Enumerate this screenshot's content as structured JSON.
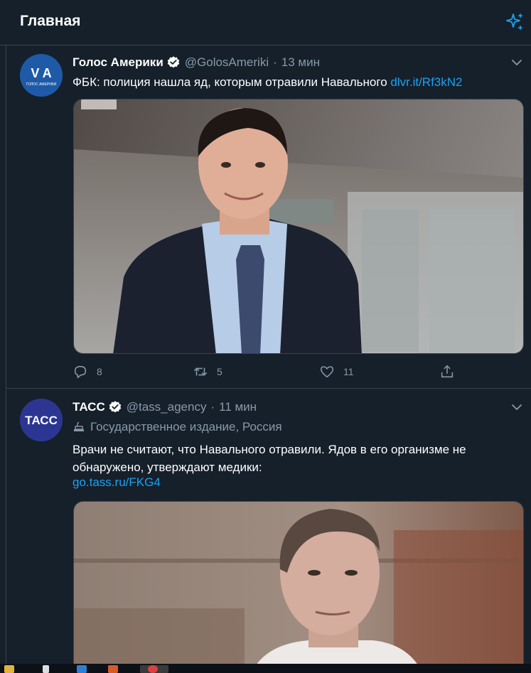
{
  "header": {
    "title": "Главная",
    "sparkle_icon": "sparkle-icon"
  },
  "tweets": [
    {
      "name": "Голос Америки",
      "handle": "@GolosAmeriki",
      "dot": "·",
      "time": "13 мин",
      "avatar_text": "V A",
      "avatar_subtext": "ГОЛОС АМЕРИКИ",
      "text": "ФБК: полиция нашла яд, которым отравили Навального ",
      "link": "dlvr.it/Rf3kN2",
      "replies": "8",
      "retweets": "5",
      "likes": "11"
    },
    {
      "name": "ТАСС",
      "handle": "@tass_agency",
      "dot": "·",
      "time": "11 мин",
      "avatar_text": "ТАСС",
      "label": "Государственное издание, Россия",
      "text": "Врачи не считают, что Навального отравили. Ядов в его организме не обнаружено, утверждают медики:",
      "link": "go.tass.ru/FKG4"
    }
  ],
  "colors": {
    "background": "#15202b",
    "border": "#38444d",
    "secondary_text": "#8899a6",
    "accent": "#1da1f2"
  }
}
